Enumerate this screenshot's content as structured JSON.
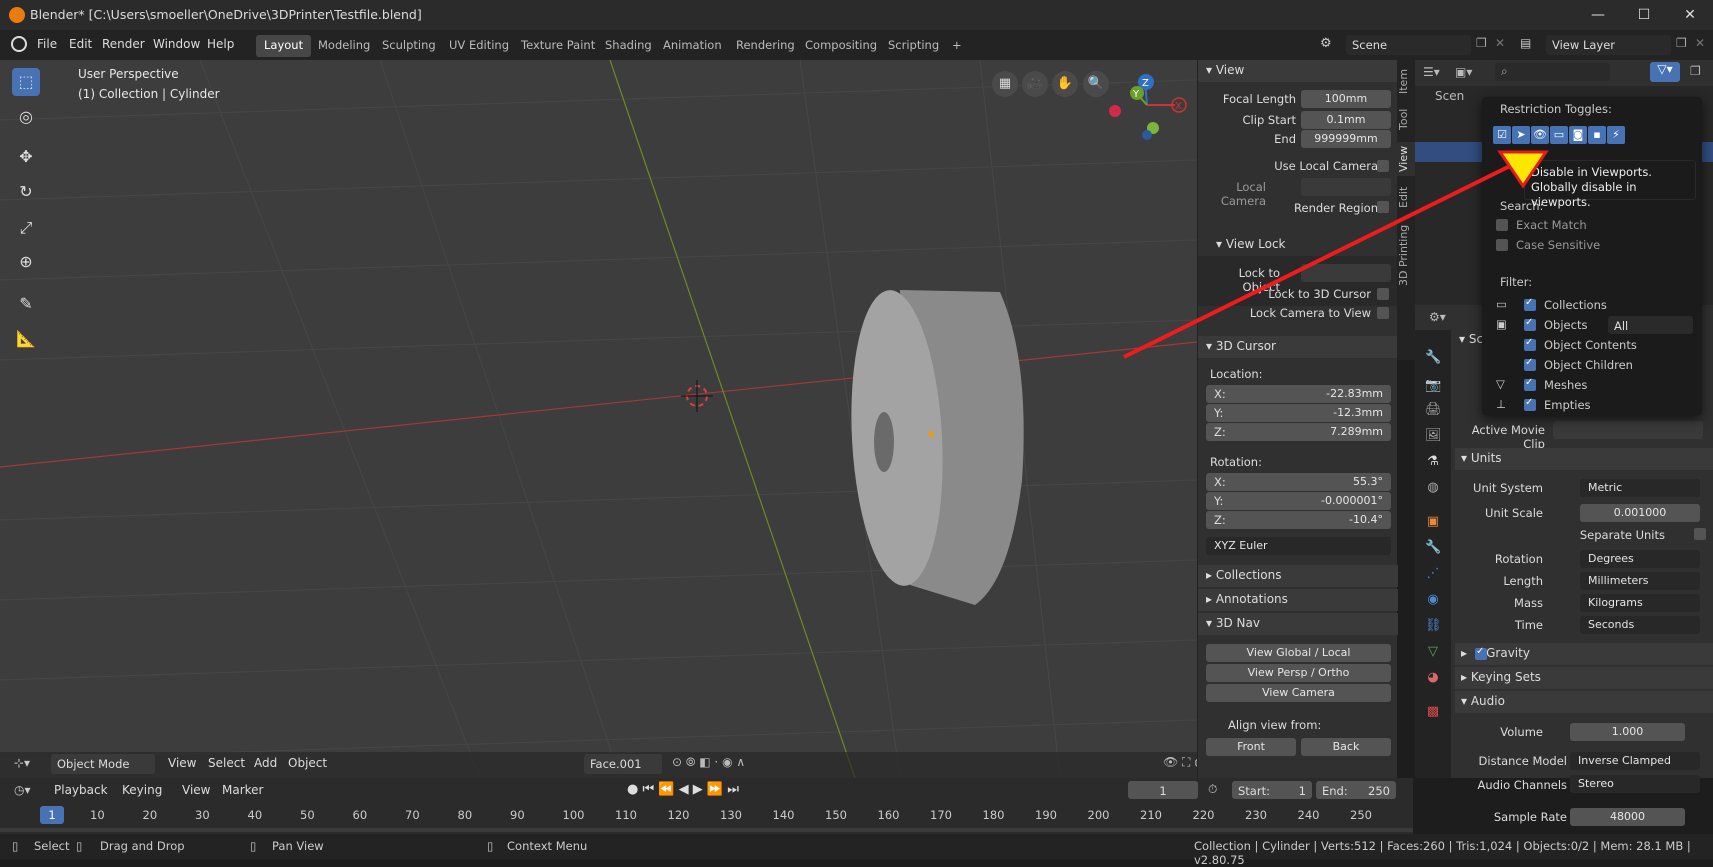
{
  "window": {
    "title": "Blender* [C:\\Users\\smoeller\\OneDrive\\3DPrinter\\Testfile.blend]",
    "minimize": "—",
    "maximize": "☐",
    "close": "✕"
  },
  "menu": [
    "File",
    "Edit",
    "Render",
    "Window",
    "Help"
  ],
  "workspaces": [
    "Layout",
    "Modeling",
    "Sculpting",
    "UV Editing",
    "Texture Paint",
    "Shading",
    "Animation",
    "Rendering",
    "Compositing",
    "Scripting"
  ],
  "workspace_add": "+",
  "scene": {
    "value": "Scene"
  },
  "view_layer": {
    "value": "View Layer"
  },
  "viewport": {
    "perspective": "User Perspective",
    "collection": "(1) Collection | Cylinder",
    "header": {
      "mode": "Object Mode",
      "view": "View",
      "select": "Select",
      "add": "Add",
      "object": "Object",
      "orientation": "Face.001"
    }
  },
  "gizmo": {
    "x": "X",
    "y": "Y",
    "z": "Z"
  },
  "npanel": {
    "view_header": "View",
    "focal_length_label": "Focal Length",
    "focal_length": "100mm",
    "clip_start_label": "Clip Start",
    "clip_start": "0.1mm",
    "end_label": "End",
    "end": "999999mm",
    "use_local_camera": "Use Local Camera",
    "local_camera": "Local Camera",
    "render_region": "Render Region",
    "view_lock": "View Lock",
    "lock_to_object": "Lock to Object",
    "lock_to_cursor": "Lock to 3D Cursor",
    "lock_camera": "Lock Camera to View",
    "cursor_header": "3D Cursor",
    "location": "Location:",
    "loc_x_label": "X:",
    "loc_x": "-22.83mm",
    "loc_y_label": "Y:",
    "loc_y": "-12.3mm",
    "loc_z_label": "Z:",
    "loc_z": "7.289mm",
    "rotation": "Rotation:",
    "rot_x_label": "X:",
    "rot_x": "55.3°",
    "rot_y_label": "Y:",
    "rot_y": "-0.000001°",
    "rot_z_label": "Z:",
    "rot_z": "-10.4°",
    "rot_mode": "XYZ Euler",
    "collections": "Collections",
    "annotations": "Annotations",
    "nav_header": "3D Nav",
    "global_local": "View Global / Local",
    "persp_ortho": "View Persp / Ortho",
    "view_camera": "View Camera",
    "align_from": "Align view from:",
    "front": "Front",
    "back": "Back"
  },
  "vtabs": [
    "Item",
    "Tool",
    "View",
    "Edit",
    "3D Printing"
  ],
  "outliner": {
    "scene_row": "Scen"
  },
  "popup": {
    "restriction": "Restriction Toggles:",
    "search": "Search:",
    "exact": "Exact Match",
    "case": "Case Sensitive",
    "filter": "Filter:",
    "collections": "Collections",
    "objects": "Objects",
    "objects_type": "All",
    "contents": "Object Contents",
    "children": "Object Children",
    "meshes": "Meshes",
    "empties": "Empties"
  },
  "tooltip": {
    "line1": "Disable in Viewports.",
    "line2": "Globally disable in viewports."
  },
  "props": {
    "active_clip": "Active Movie Clip",
    "units": "Units",
    "unit_system_label": "Unit System",
    "unit_system": "Metric",
    "unit_scale_label": "Unit Scale",
    "unit_scale": "0.001000",
    "separate": "Separate Units",
    "rotation_label": "Rotation",
    "rotation": "Degrees",
    "length_label": "Length",
    "length": "Millimeters",
    "mass_label": "Mass",
    "mass": "Kilograms",
    "time_label": "Time",
    "time": "Seconds",
    "gravity": "Gravity",
    "keying": "Keying Sets",
    "audio": "Audio",
    "volume_label": "Volume",
    "volume": "1.000",
    "distance_label": "Distance Model",
    "distance": "Inverse Clamped",
    "channels_label": "Audio Channels",
    "channels": "Stereo",
    "rate_label": "Sample Rate",
    "rate": "48000",
    "sc": "Sc"
  },
  "timeline": {
    "playback": "Playback",
    "keying": "Keying",
    "view": "View",
    "marker": "Marker",
    "frame": "1",
    "start_label": "Start:",
    "start": "1",
    "end_label": "End:",
    "end": "250",
    "current": "1",
    "ticks": [
      "10",
      "20",
      "30",
      "40",
      "50",
      "60",
      "70",
      "80",
      "90",
      "100",
      "110",
      "120",
      "130",
      "140",
      "150",
      "160",
      "170",
      "180",
      "190",
      "200",
      "210",
      "220",
      "230",
      "240",
      "250"
    ]
  },
  "status": {
    "select": "Select",
    "drag": "Drag and Drop",
    "pan": "Pan View",
    "context": "Context Menu",
    "info": "Collection | Cylinder | Verts:512 | Faces:260 | Tris:1,024 | Objects:0/2 | Mem: 28.1 MB | v2.80.75"
  }
}
